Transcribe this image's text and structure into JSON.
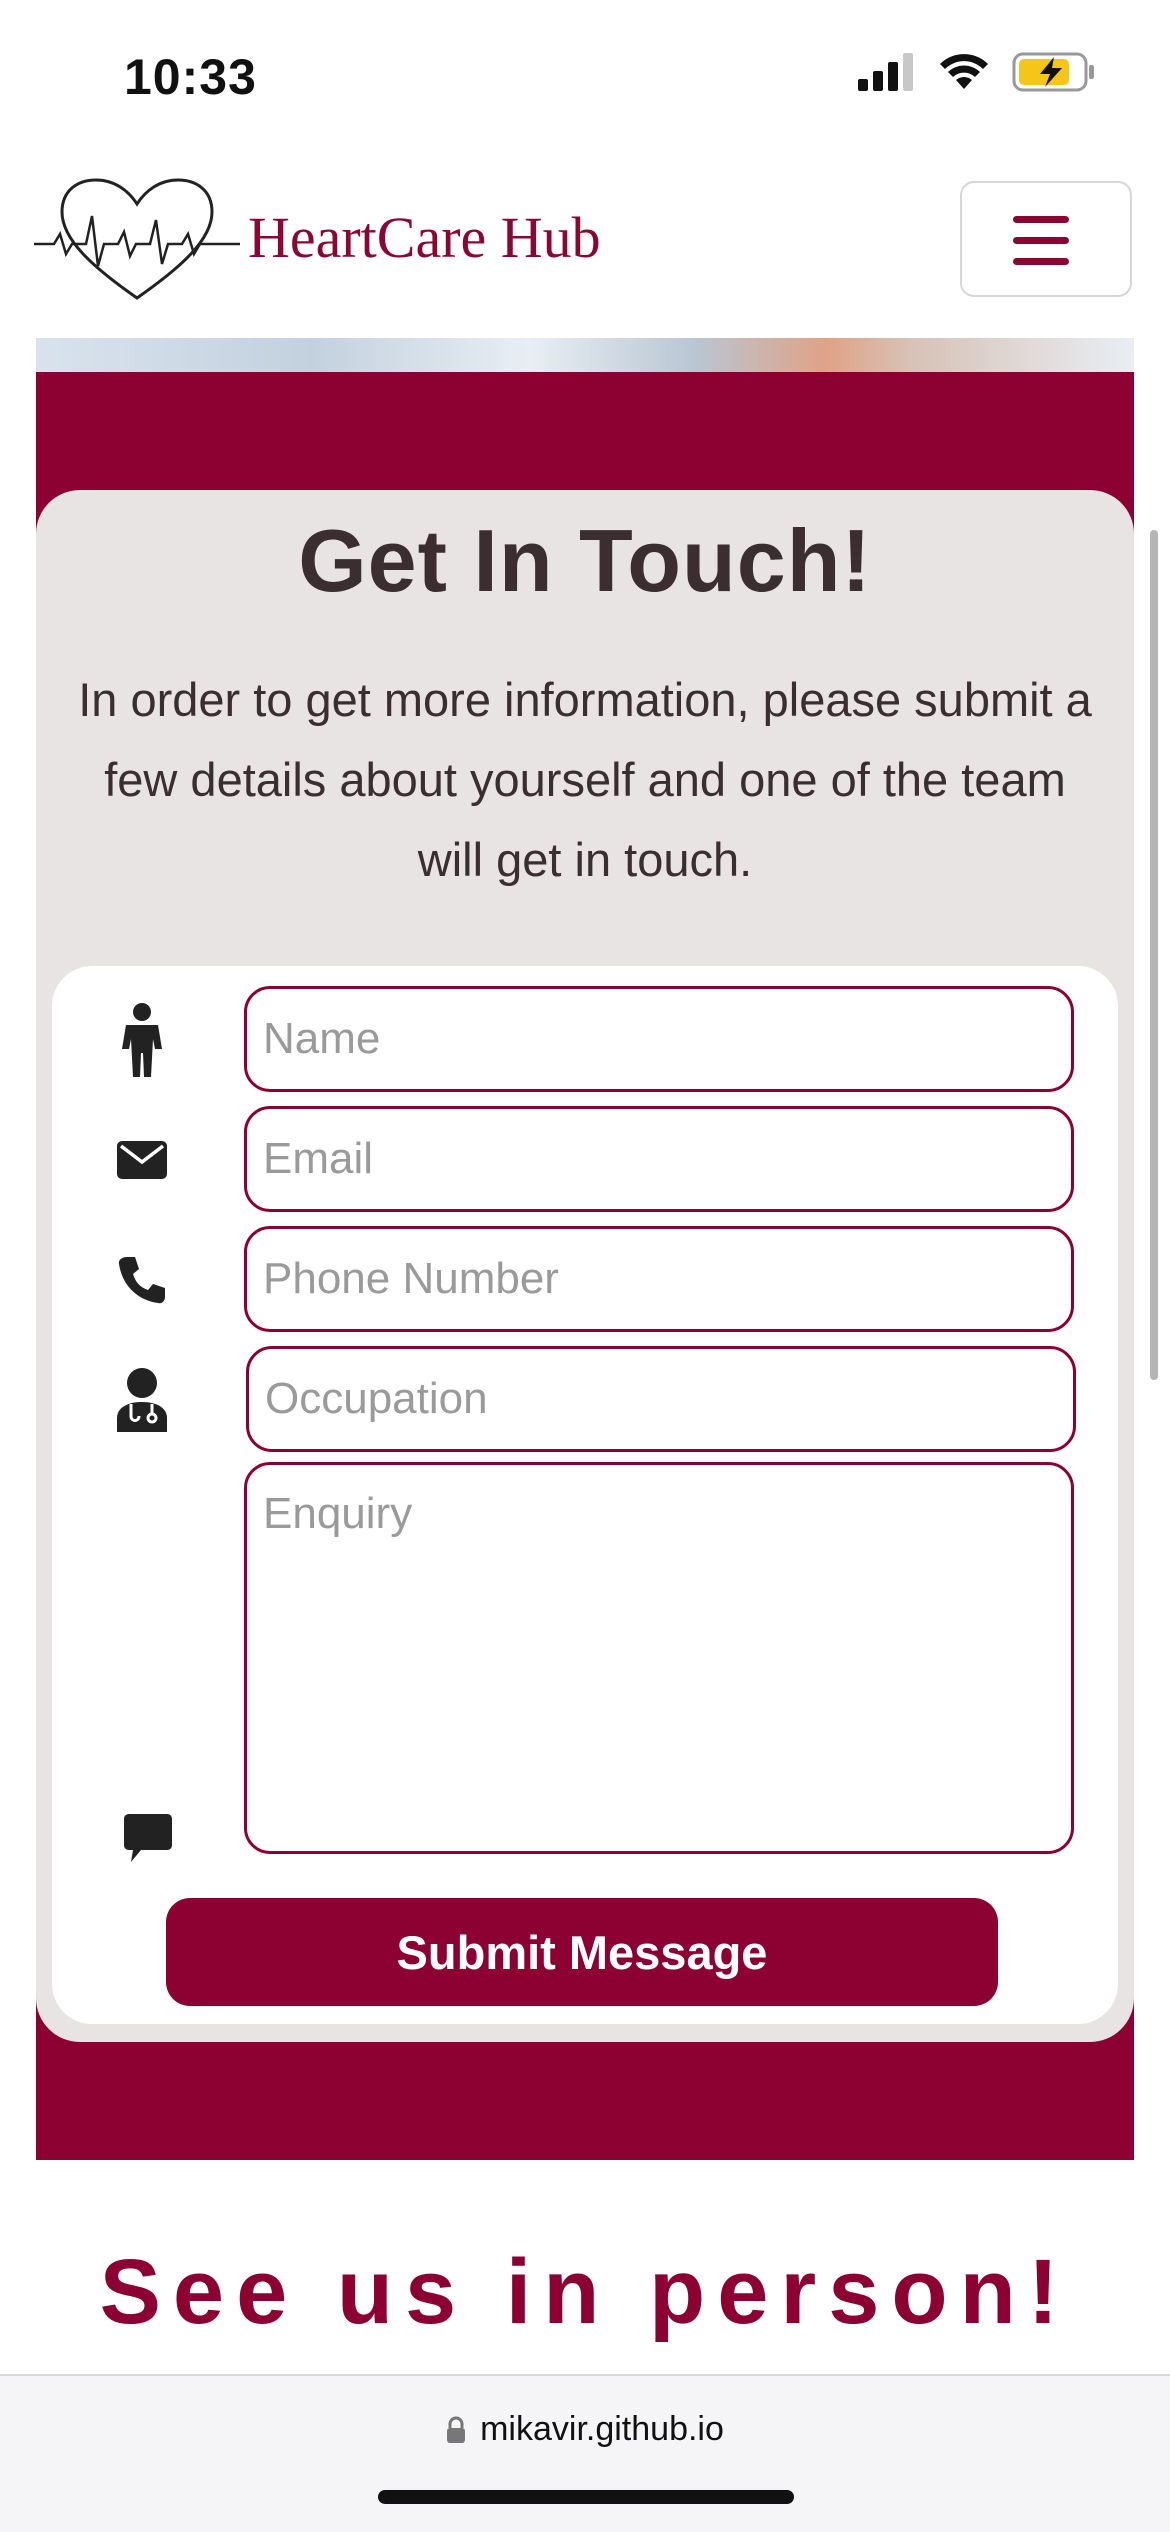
{
  "status_bar": {
    "time": "10:33"
  },
  "header": {
    "brand_name": "HeartCare Hub"
  },
  "contact": {
    "title": "Get In Touch!",
    "intro": "In order to get more information, please submit a few details about yourself and one of the team will get in touch.",
    "fields": {
      "name_placeholder": "Name",
      "email_placeholder": "Email",
      "phone_placeholder": "Phone Number",
      "occupation_placeholder": "Occupation",
      "enquiry_placeholder": "Enquiry"
    },
    "submit_label": "Submit Message"
  },
  "visit": {
    "heading": "See us in person!"
  },
  "browser": {
    "url": "mikavir.github.io"
  },
  "colors": {
    "brand": "#8c0032",
    "card_bg": "#e8e4e4",
    "text": "#3a2e30"
  }
}
